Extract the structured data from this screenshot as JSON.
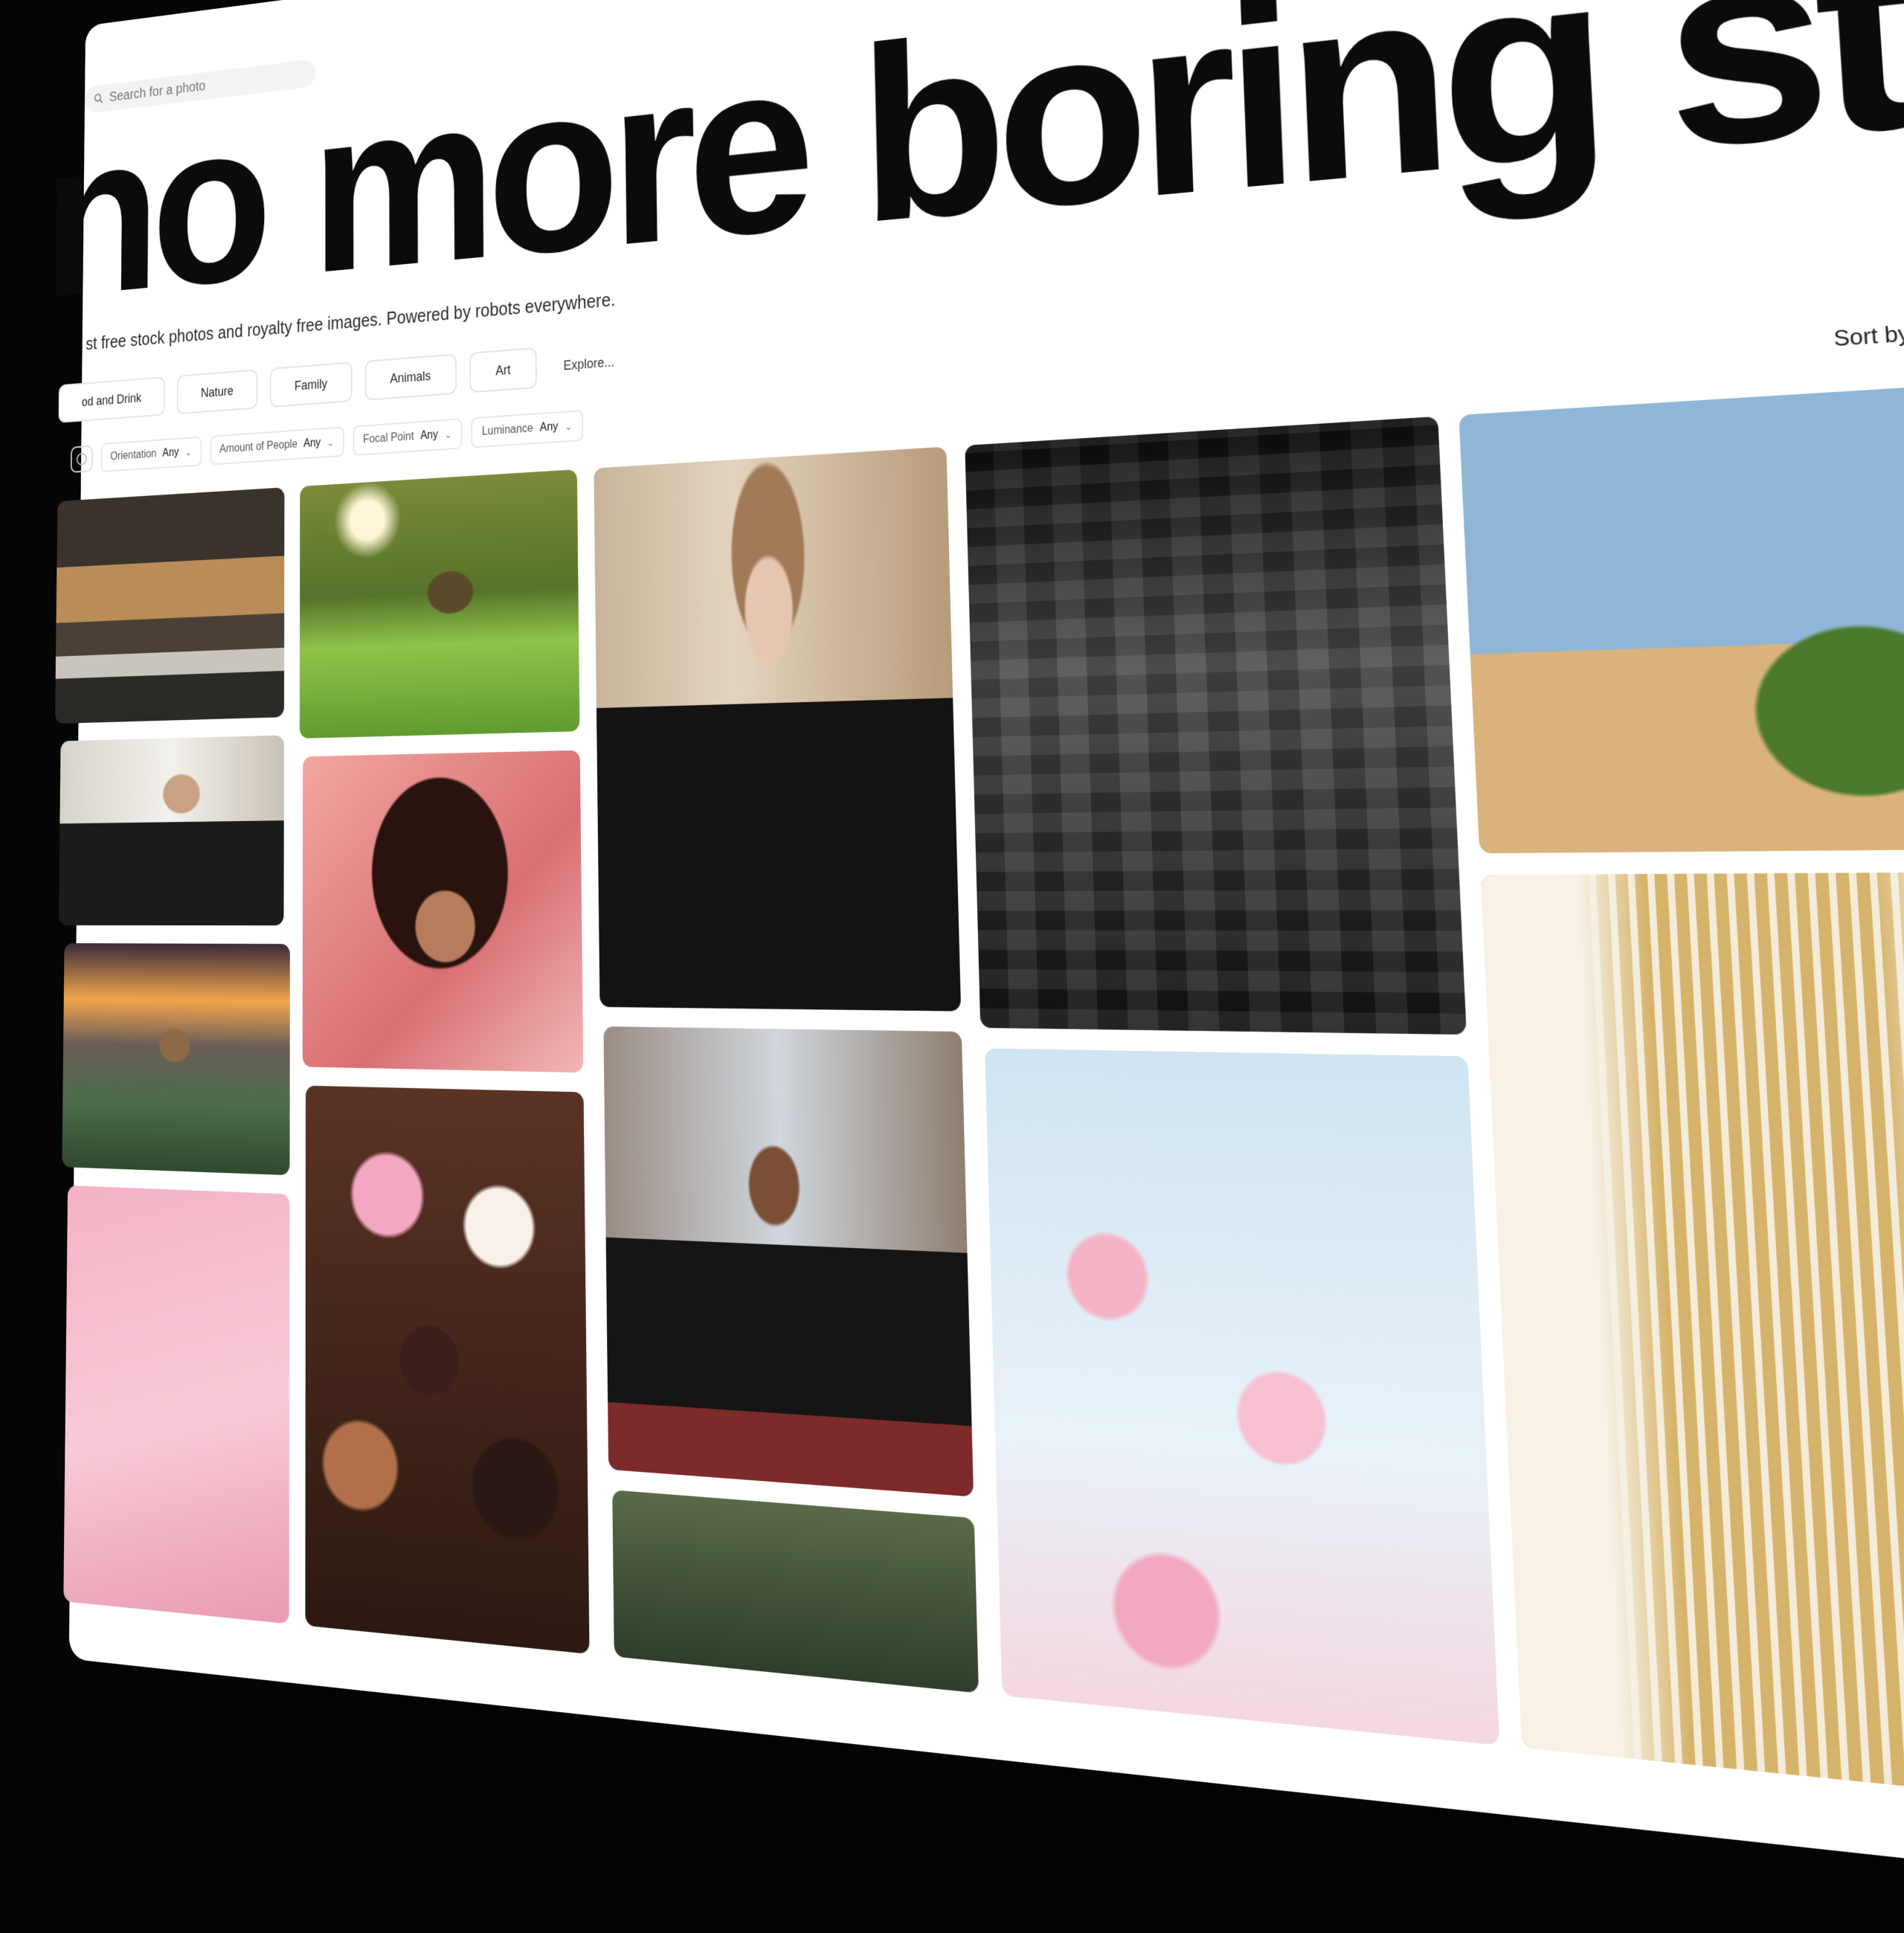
{
  "search": {
    "placeholder": "Search for a photo"
  },
  "hero": {
    "title": "no more boring stock",
    "subtitle": "st free stock photos and royalty free images. Powered by robots everywhere."
  },
  "categories": [
    "od and Drink",
    "Nature",
    "Family",
    "Animals",
    "Art",
    "Explore..."
  ],
  "filters": [
    {
      "label": "Orientation",
      "value": "Any"
    },
    {
      "label": "Amount of People",
      "value": "Any"
    },
    {
      "label": "Focal Point",
      "value": "Any"
    },
    {
      "label": "Luminance",
      "value": "Any"
    }
  ],
  "sort": {
    "label": "Sort by"
  },
  "photos": [
    {
      "name": "photo-woman-meditating-house",
      "style": "p-house"
    },
    {
      "name": "photo-olive-tree",
      "style": "p-olive"
    },
    {
      "name": "photo-woman-black-lace",
      "style": "p-woman1"
    },
    {
      "name": "photo-cinema-3d-glasses",
      "style": "p-cinema"
    },
    {
      "name": "photo-desert-bush",
      "style": "p-desert"
    },
    {
      "name": "photo-man-office",
      "style": "p-man1"
    },
    {
      "name": "photo-woman-curly-hair",
      "style": "p-woman2"
    },
    {
      "name": "photo-coyote-sunset",
      "style": "p-coyote"
    },
    {
      "name": "photo-young-man-street",
      "style": "p-boy"
    },
    {
      "name": "photo-pipe-organ",
      "style": "p-organ"
    },
    {
      "name": "photo-pink-abstract",
      "style": "p-pink"
    },
    {
      "name": "photo-donuts",
      "style": "p-donuts"
    },
    {
      "name": "photo-pink-flowers",
      "style": "p-flowers"
    },
    {
      "name": "photo-plant",
      "style": "p-plant"
    }
  ]
}
